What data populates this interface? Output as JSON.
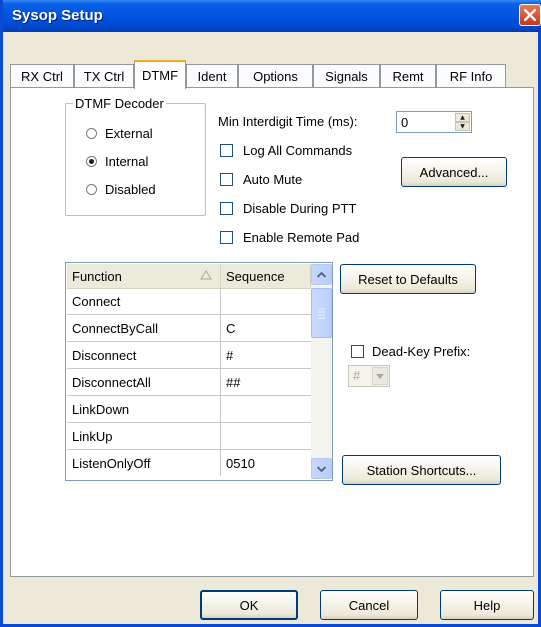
{
  "window": {
    "title": "Sysop Setup"
  },
  "tabs": [
    "RX Ctrl",
    "TX Ctrl",
    "DTMF",
    "Ident",
    "Options",
    "Signals",
    "Remt",
    "RF Info"
  ],
  "active_tab": "DTMF",
  "decoder": {
    "legend": "DTMF Decoder",
    "options": [
      "External",
      "Internal",
      "Disabled"
    ],
    "selected": "Internal"
  },
  "interdigit": {
    "label": "Min Interdigit Time (ms):",
    "value": "0"
  },
  "checkboxes": {
    "log_all": "Log All Commands",
    "auto_mute": "Auto Mute",
    "disable_ptt": "Disable During PTT",
    "remote_pad": "Enable Remote Pad",
    "dead_key": "Dead-Key Prefix:"
  },
  "buttons": {
    "advanced": "Advanced...",
    "reset": "Reset to Defaults",
    "shortcuts": "Station Shortcuts...",
    "ok": "OK",
    "cancel": "Cancel",
    "help": "Help"
  },
  "grid": {
    "columns": [
      "Function",
      "Sequence"
    ],
    "rows": [
      {
        "function": "Connect",
        "sequence": ""
      },
      {
        "function": "ConnectByCall",
        "sequence": "C"
      },
      {
        "function": "Disconnect",
        "sequence": "#"
      },
      {
        "function": "DisconnectAll",
        "sequence": "##"
      },
      {
        "function": "LinkDown",
        "sequence": ""
      },
      {
        "function": "LinkUp",
        "sequence": ""
      },
      {
        "function": "ListenOnlyOff",
        "sequence": "0510"
      }
    ]
  },
  "dead_key_prefix": {
    "value": "#"
  },
  "icons": [
    "close-icon",
    "sort-ascending-icon",
    "scroll-up-arrow-icon",
    "scroll-down-arrow-icon",
    "spin-up-icon",
    "spin-down-icon",
    "combo-dropdown-icon"
  ]
}
